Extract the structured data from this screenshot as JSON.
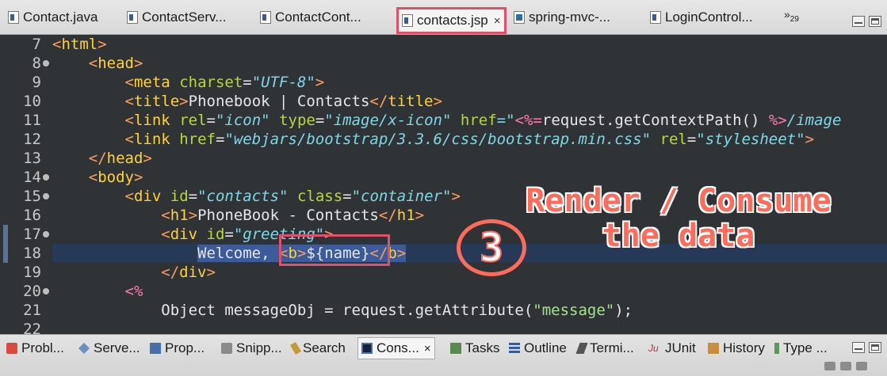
{
  "editor_tabs": [
    {
      "label": "Contact.java",
      "icon": "java-file-icon"
    },
    {
      "label": "ContactServ...",
      "icon": "java-file-icon"
    },
    {
      "label": "ContactCont...",
      "icon": "java-file-icon"
    },
    {
      "label": "contacts.jsp",
      "icon": "jsp-file-icon",
      "active": true
    },
    {
      "label": "spring-mvc-...",
      "icon": "maven-file-icon"
    },
    {
      "label": "LoginControl...",
      "icon": "java-file-icon"
    }
  ],
  "tabs_overflow": {
    "symbol": "»",
    "count": "29"
  },
  "code": {
    "ln7": "7",
    "ln8": "8",
    "ln9": "9",
    "ln10": "10",
    "ln11": "11",
    "ln12": "12",
    "ln13": "13",
    "ln14": "14",
    "ln15": "15",
    "ln16": "16",
    "ln17": "17",
    "ln18": "18",
    "ln19": "19",
    "ln20": "20",
    "ln21": "21",
    "ln22": "22",
    "charset_value": "\"UTF-8\"",
    "title_text": "Phonebook | Contacts",
    "icon_rel": "\"icon\"",
    "icon_type": "\"image/x-icon\"",
    "context_path": "request.getContextPath() ",
    "icon_href_tail": "/image",
    "css_href": "\"webjars/bootstrap/3.3.6/css/bootstrap.min.css\"",
    "css_rel": "\"stylesheet\"",
    "div_id": "\"contacts\"",
    "div_class": "\"container\"",
    "h1_text": "PhoneBook - Contacts",
    "greeting_id": "\"greeting\"",
    "welcome": "Welcome, ",
    "name_expr": "${name}",
    "java_line": "Object messageObj = request.getAttribute(",
    "java_arg": "\"message\"",
    "java_end": ");"
  },
  "annotation": {
    "number": "3",
    "line1": "Render / Consume",
    "line2": "the data",
    "color": "#ff6b5b"
  },
  "view_tabs": [
    {
      "label": "Probl...",
      "icon": "problems-icon"
    },
    {
      "label": "Serve...",
      "icon": "servers-icon"
    },
    {
      "label": "Prop...",
      "icon": "properties-icon"
    },
    {
      "label": "Snipp...",
      "icon": "snippets-icon"
    },
    {
      "label": "Search",
      "icon": "search-icon"
    },
    {
      "label": "Cons...",
      "icon": "console-icon",
      "active": true
    },
    {
      "label": "Tasks",
      "icon": "tasks-icon"
    },
    {
      "label": "Outline",
      "icon": "outline-icon"
    },
    {
      "label": "Termi...",
      "icon": "terminal-icon"
    },
    {
      "label": "JUnit",
      "icon": "junit-icon"
    },
    {
      "label": "History",
      "icon": "history-icon"
    },
    {
      "label": "Type ...",
      "icon": "type-hierarchy-icon"
    }
  ],
  "close_symbol": "×"
}
